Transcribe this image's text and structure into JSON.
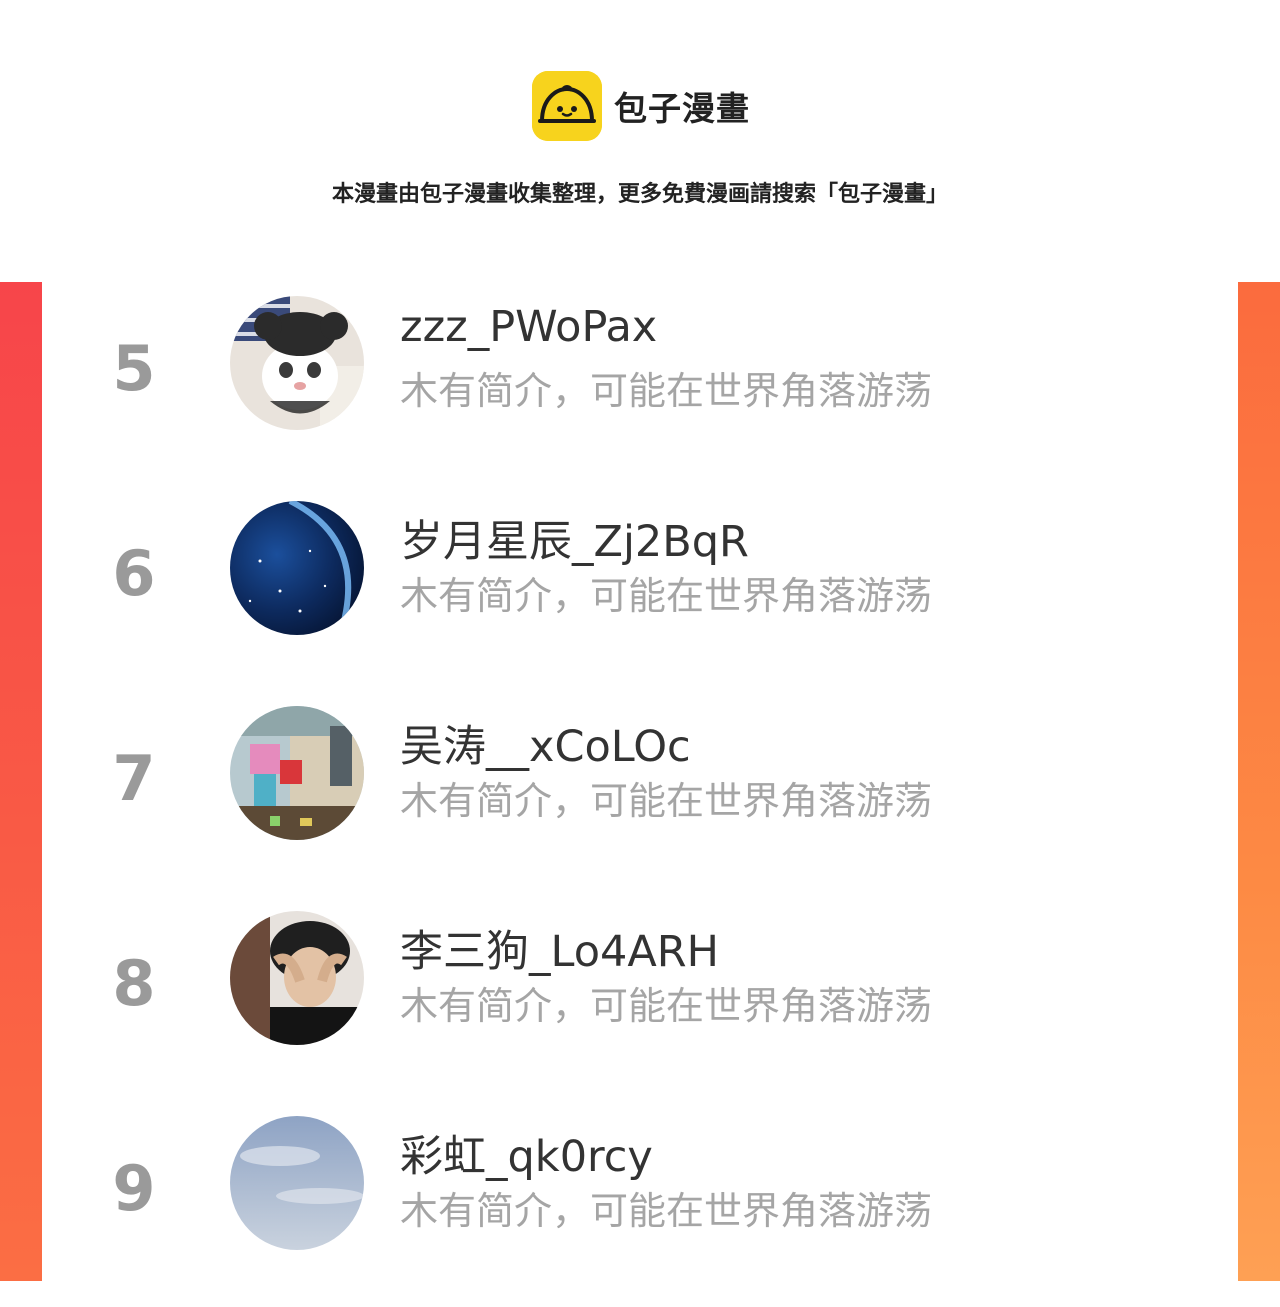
{
  "header": {
    "app_name": "包子漫畫",
    "logo_icon": "bun-mascot-icon",
    "brand_color": "#f7d31d",
    "tagline": "本漫畫由包子漫畫收集整理，更多免費漫画請搜索「包子漫畫」"
  },
  "theme": {
    "left_bar_color": "#f7454a",
    "right_bar_color": "#fd8a44",
    "rank_color": "#9a9a9a",
    "bio_color": "#a5a5a5"
  },
  "list": {
    "items": [
      {
        "rank": "5",
        "name": "zzz_PWoPax",
        "bio": "木有简介，可能在世界角落游荡",
        "avatar": "cat-avatar-icon"
      },
      {
        "rank": "6",
        "name": "岁月星辰_Zj2BqR",
        "bio": "木有简介，可能在世界角落游荡",
        "avatar": "planet-avatar-icon"
      },
      {
        "rank": "7",
        "name": "吴涛__xCoLOc",
        "bio": "木有简介，可能在世界角落游荡",
        "avatar": "blocky-game-avatar-icon"
      },
      {
        "rank": "8",
        "name": "李三狗_Lo4ARH",
        "bio": "木有简介，可能在世界角落游荡",
        "avatar": "person-avatar-icon"
      },
      {
        "rank": "9",
        "name": "彩虹_qk0rcy",
        "bio": "木有简介，可能在世界角落游荡",
        "avatar": "sky-avatar-icon"
      }
    ]
  }
}
